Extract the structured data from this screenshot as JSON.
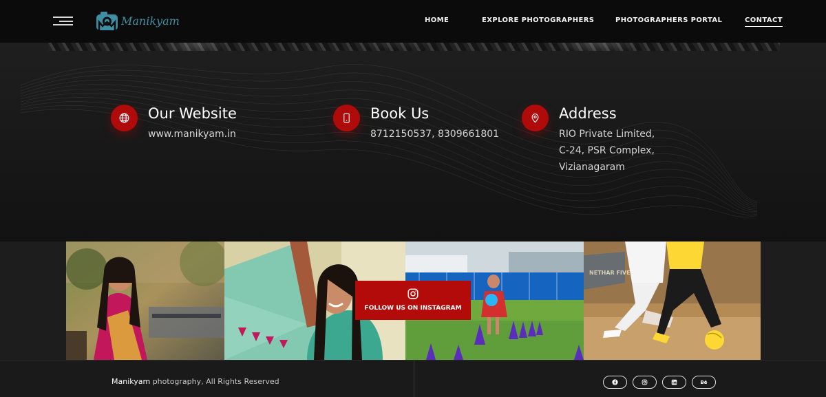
{
  "brand": {
    "name": "Manikyam",
    "accent": "#3f8fa4"
  },
  "nav": {
    "items": [
      {
        "label": "HOME"
      },
      {
        "label": "EXPLORE PHOTOGRAPHERS"
      },
      {
        "label": "PHOTOGRAPHERS PORTAL"
      },
      {
        "label": "CONTACT",
        "active": true
      }
    ]
  },
  "contact": {
    "website": {
      "title": "Our Website",
      "lines": [
        "www.manikyam.in"
      ],
      "icon": "globe-icon"
    },
    "book": {
      "title": "Book Us",
      "lines": [
        "8712150537, 8309661801"
      ],
      "icon": "phone-icon"
    },
    "address": {
      "title": "Address",
      "lines": [
        "RIO Private Limited,",
        "C-24, PSR Complex,",
        "Vizianagaram"
      ],
      "icon": "location-pin-icon"
    },
    "icon_color": "#b00b0b"
  },
  "instagram": {
    "label": "FOLLOW US ON INSTAGRAM",
    "box_color": "#b30a0a"
  },
  "footer": {
    "brand": "Manikyam",
    "rights": " photography, All Rights Reserved",
    "social": [
      "facebook-icon",
      "instagram-icon",
      "linkedin-icon",
      "behance-icon"
    ],
    "behance_label": "Bē"
  }
}
